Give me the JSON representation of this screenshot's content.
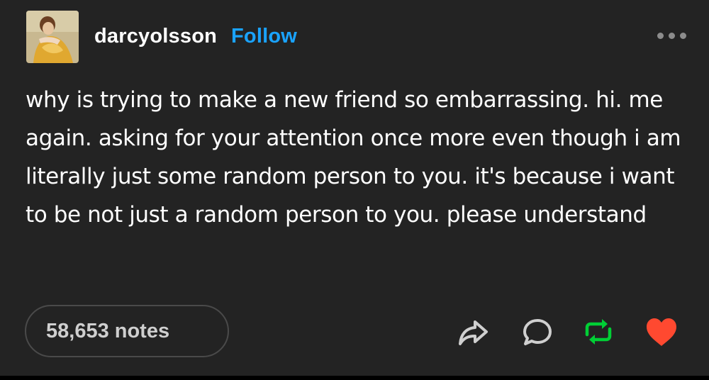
{
  "post": {
    "username": "darcyolsson",
    "follow_label": "Follow",
    "body": "why is trying to make a new friend so embarrassing. hi. me again. asking for your attention once more even though i am literally just some random person to you. it's because i want to be not just a random person to you. please understand",
    "notes_label": "58,653 notes"
  },
  "icons": {
    "more": "more-dots-icon",
    "share": "share-arrow-icon",
    "reply": "reply-bubble-icon",
    "reblog": "reblog-icon",
    "like": "heart-icon"
  },
  "colors": {
    "background": "#232323",
    "follow": "#1aa3ff",
    "reblog_active": "#00cf35",
    "like_active": "#ff4930"
  }
}
